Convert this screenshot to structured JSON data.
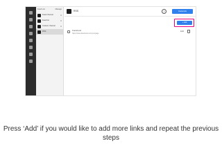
{
  "sidebar": {
    "header": {
      "left": "Feed List",
      "right": "Manage"
    },
    "items": [
      {
        "label": "Feed channel"
      },
      {
        "label": "Feed list"
      },
      {
        "label": "Custom channel"
      },
      {
        "label": "RSS"
      }
    ],
    "active_index": 3
  },
  "topbar": {
    "title": "RSS",
    "help_icon": "help-circle-icon",
    "help_glyph": "?",
    "customize_label": "Customize"
  },
  "toolbar": {
    "add_label": "+ Add"
  },
  "links": [
    {
      "title": "Facebook",
      "url": "https://www.facebook.com/yourpage",
      "edit_label": "Edit"
    }
  ],
  "caption": "Press ‘Add’ if you would like to add more links and repeat the previous steps",
  "colors": {
    "accent": "#2f80ed",
    "highlight": "#e6007e",
    "rail": "#2c2c2c"
  }
}
